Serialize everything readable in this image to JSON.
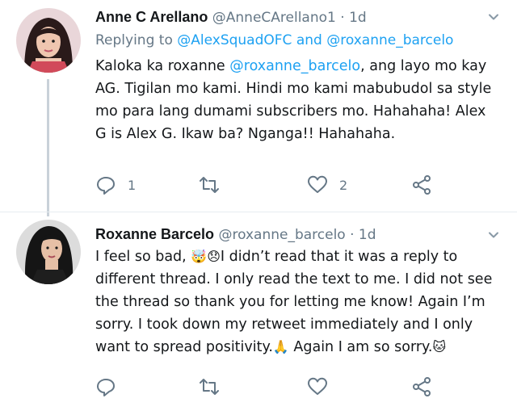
{
  "tweets": [
    {
      "name": "Anne C Arellano",
      "handle": "@AnneCArellano1",
      "dot": "·",
      "time": "1d",
      "replying_prefix": "Replying to",
      "replying_user1": "@AlexSquadOFC",
      "replying_and": "and",
      "replying_user2": "@roxanne_barcelo",
      "body_pre": "Kaloka ka roxanne ",
      "body_mention": "@roxanne_barcelo",
      "body_post": ", ang layo mo kay AG. Tigilan mo kami. Hindi mo kami mabubudol sa style mo para lang dumami subscribers mo. Hahahaha! Alex G is Alex G. Ikaw ba? Nganga!! Hahahaha.",
      "reply_count": "1",
      "retweet_count": "",
      "like_count": "2"
    },
    {
      "name": "Roxanne Barcelo",
      "handle": "@roxanne_barcelo",
      "dot": "·",
      "time": "1d",
      "body_1": "I feel so bad, ",
      "emoji_1": "🤯😞",
      "body_2": "I didn’t read that it was a reply to different thread. I only read the text to me. I did not see the thread so thank you for letting me know! Again I’m sorry. I took down my retweet immediately and I only want to spread positivity.",
      "emoji_2": "🙏",
      "body_3": " Again I am so sorry.",
      "emoji_3": "🐱",
      "reply_count": "",
      "retweet_count": "",
      "like_count": ""
    }
  ],
  "colors": {
    "link": "#1da1f2",
    "secondary": "#657786",
    "text": "#14171a"
  },
  "icons": [
    "reply-icon",
    "retweet-icon",
    "like-icon",
    "share-icon",
    "chevron-down-icon"
  ]
}
